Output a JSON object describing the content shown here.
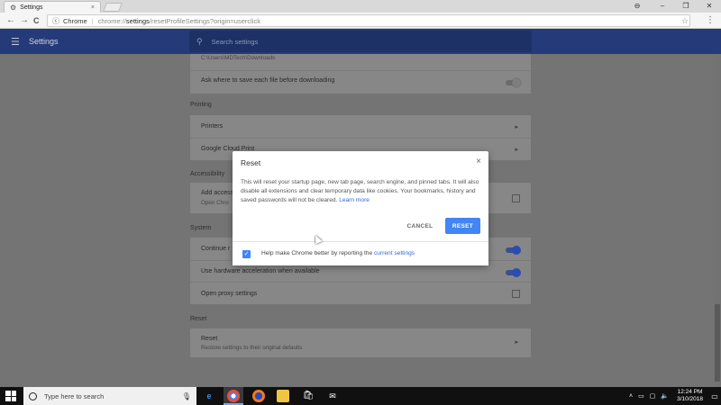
{
  "browser": {
    "tab_title": "Settings",
    "tab_close": "×",
    "window_controls": {
      "account": "⊖",
      "minimize": "–",
      "maximize": "❐",
      "close": "✕"
    },
    "nav": {
      "back": "←",
      "forward": "→",
      "reload": "C"
    },
    "omnibox": {
      "site_label": "Chrome",
      "separator": "|",
      "scheme": "chrome://",
      "path": "settings",
      "rest": "/resetProfileSettings?origin=userclick"
    }
  },
  "appbar": {
    "title": "Settings",
    "search_placeholder": "Search settings"
  },
  "settings": {
    "downloads_path": "C:\\Users\\MDTech\\Downloads",
    "ask_save_label": "Ask where to save each file before downloading",
    "printing_title": "Printing",
    "printers_label": "Printers",
    "cloud_print_label": "Google Cloud Print",
    "accessibility_title": "Accessibility",
    "add_access_label": "Add access",
    "open_chrome_label": "Open Chro",
    "system_title": "System",
    "continue_label": "Continue r",
    "hw_accel_label": "Use hardware acceleration when available",
    "proxy_label": "Open proxy settings",
    "reset_title": "Reset",
    "reset_label": "Reset",
    "reset_sub": "Restore settings to their original defaults"
  },
  "dialog": {
    "title": "Reset",
    "close": "×",
    "body": "This will reset your startup page, new tab page, search engine, and pinned tabs. It will also disable all extensions and clear temporary data like cookies. Your bookmarks, history and saved passwords will not be cleared.",
    "learn_more": "Learn more",
    "cancel_label": "CANCEL",
    "reset_label": "RESET",
    "footer_text": "Help make Chrome better by reporting the",
    "footer_link": "current settings",
    "checkbox_checked": true
  },
  "taskbar": {
    "search_placeholder": "Type here to search",
    "time": "12:24 PM",
    "date": "3/10/2018"
  },
  "colors": {
    "accent": "#4285f4",
    "appbar": "#253a78",
    "link": "#3367d6"
  }
}
